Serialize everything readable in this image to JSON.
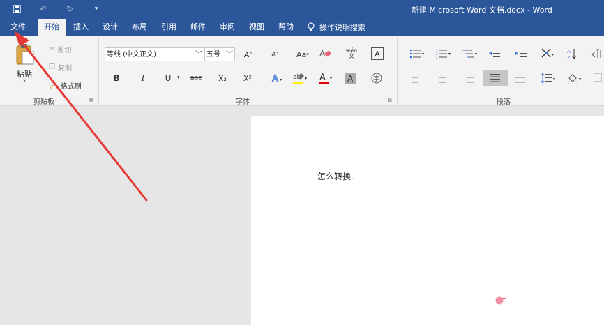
{
  "title_bar": {
    "title": "新建 Microsoft Word 文档.docx - Word"
  },
  "quick_access": {
    "save_icon": "save-icon",
    "undo_icon": "undo-icon",
    "redo_icon": "redo-icon",
    "customize_icon": "customize-qat-icon"
  },
  "tabs": [
    {
      "label": "文件"
    },
    {
      "label": "开始"
    },
    {
      "label": "插入"
    },
    {
      "label": "设计"
    },
    {
      "label": "布局"
    },
    {
      "label": "引用"
    },
    {
      "label": "邮件"
    },
    {
      "label": "审阅"
    },
    {
      "label": "视图"
    },
    {
      "label": "帮助"
    }
  ],
  "active_tab": "开始",
  "tell_me": {
    "label": "操作说明搜索",
    "icon": "lightbulb-icon"
  },
  "clipboard": {
    "group_label": "剪贴板",
    "paste_label": "粘贴",
    "cut_label": "剪切",
    "copy_label": "复制",
    "format_painter_label": "格式刷"
  },
  "font": {
    "group_label": "字体",
    "font_name": "等线 (中文正文)",
    "font_size": "五号",
    "bold": "B",
    "italic": "I",
    "underline": "U",
    "strikethrough": "abc",
    "subscript": "X₂",
    "superscript": "X²",
    "font_color_letter": "A",
    "aa_label": "Aa",
    "phonetic_label": "wén"
  },
  "paragraph": {
    "group_label": "段落"
  },
  "document": {
    "text": "怎么转换."
  },
  "colors": {
    "title_bar": "#2b579a",
    "ribbon": "#f3f3f3",
    "arrow": "#e53935"
  }
}
